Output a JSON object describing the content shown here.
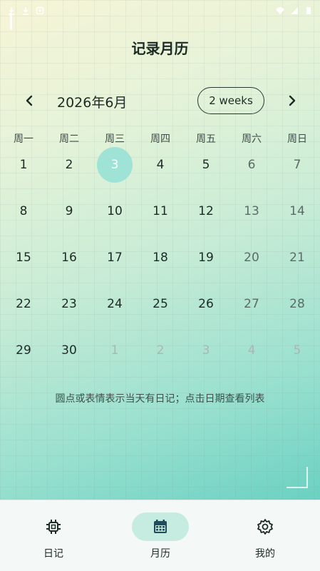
{
  "status_bar": {
    "time": "",
    "icons": [
      "download-icon",
      "download-icon",
      "notification-icon",
      "wifi-icon",
      "signal-icon",
      "battery-icon"
    ]
  },
  "header": {
    "title": "记录月历"
  },
  "month_nav": {
    "month_label": "2026年6月",
    "view_toggle": "2 weeks",
    "prev_icon": "chevron-left-icon",
    "next_icon": "chevron-right-icon"
  },
  "weekdays": [
    "周一",
    "周二",
    "周三",
    "周四",
    "周五",
    "周六",
    "周日"
  ],
  "calendar": {
    "selected_day": "3",
    "weeks": [
      [
        "1",
        "2",
        "3",
        "4",
        "5",
        "6",
        "7"
      ],
      [
        "8",
        "9",
        "10",
        "11",
        "12",
        "13",
        "14"
      ],
      [
        "15",
        "16",
        "17",
        "18",
        "19",
        "20",
        "21"
      ],
      [
        "22",
        "23",
        "24",
        "25",
        "26",
        "27",
        "28"
      ],
      [
        "29",
        "30",
        "1",
        "2",
        "3",
        "4",
        "5"
      ]
    ],
    "other_month_cells_from_index": 30
  },
  "hint": "圆点或表情表示当天有日记；点击日期查看列表",
  "bottom_nav": {
    "items": [
      {
        "label": "日记",
        "icon": "chip-icon"
      },
      {
        "label": "月历",
        "icon": "calendar-icon"
      },
      {
        "label": "我的",
        "icon": "gear-icon"
      }
    ],
    "active_index": 1
  },
  "colors": {
    "accent": "#9ee3d5",
    "text": "#1d2b26",
    "muted": "#a9b7b2",
    "calendar_icon": "#1f4d5c"
  }
}
